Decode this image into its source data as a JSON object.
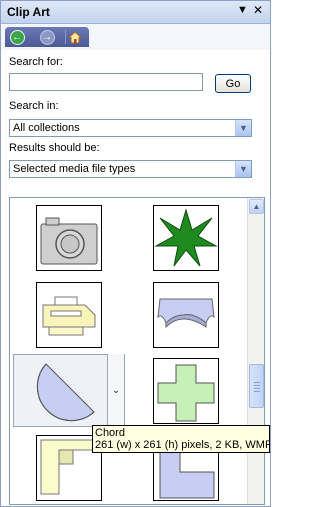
{
  "panel": {
    "title": "Clip Art"
  },
  "search": {
    "label": "Search for:",
    "value": "",
    "go_label": "Go"
  },
  "search_in": {
    "label": "Search in:",
    "value": "All collections"
  },
  "results_type": {
    "label": "Results should be:",
    "value": "Selected media file types"
  },
  "results": {
    "items": [
      {
        "icon": "camera"
      },
      {
        "icon": "green-leaf-star"
      },
      {
        "icon": "printer"
      },
      {
        "icon": "curved-banner"
      },
      {
        "icon": "chord"
      },
      {
        "icon": "cross-plus"
      },
      {
        "icon": "yellow-corner-frame"
      },
      {
        "icon": "purple-l-shape"
      }
    ]
  },
  "tooltip": {
    "name": "Chord",
    "details": "261 (w) x 261 (h) pixels, 2 KB, WMF"
  },
  "colors": {
    "title_bar": "#c3d3ee",
    "nav_strip": "#5866a6",
    "shape_fill_lavender": "#c8cdf3",
    "shape_fill_green": "#c6f0b8",
    "shape_fill_yellow": "#fbfbcc",
    "tooltip_bg": "#ffffe1"
  }
}
